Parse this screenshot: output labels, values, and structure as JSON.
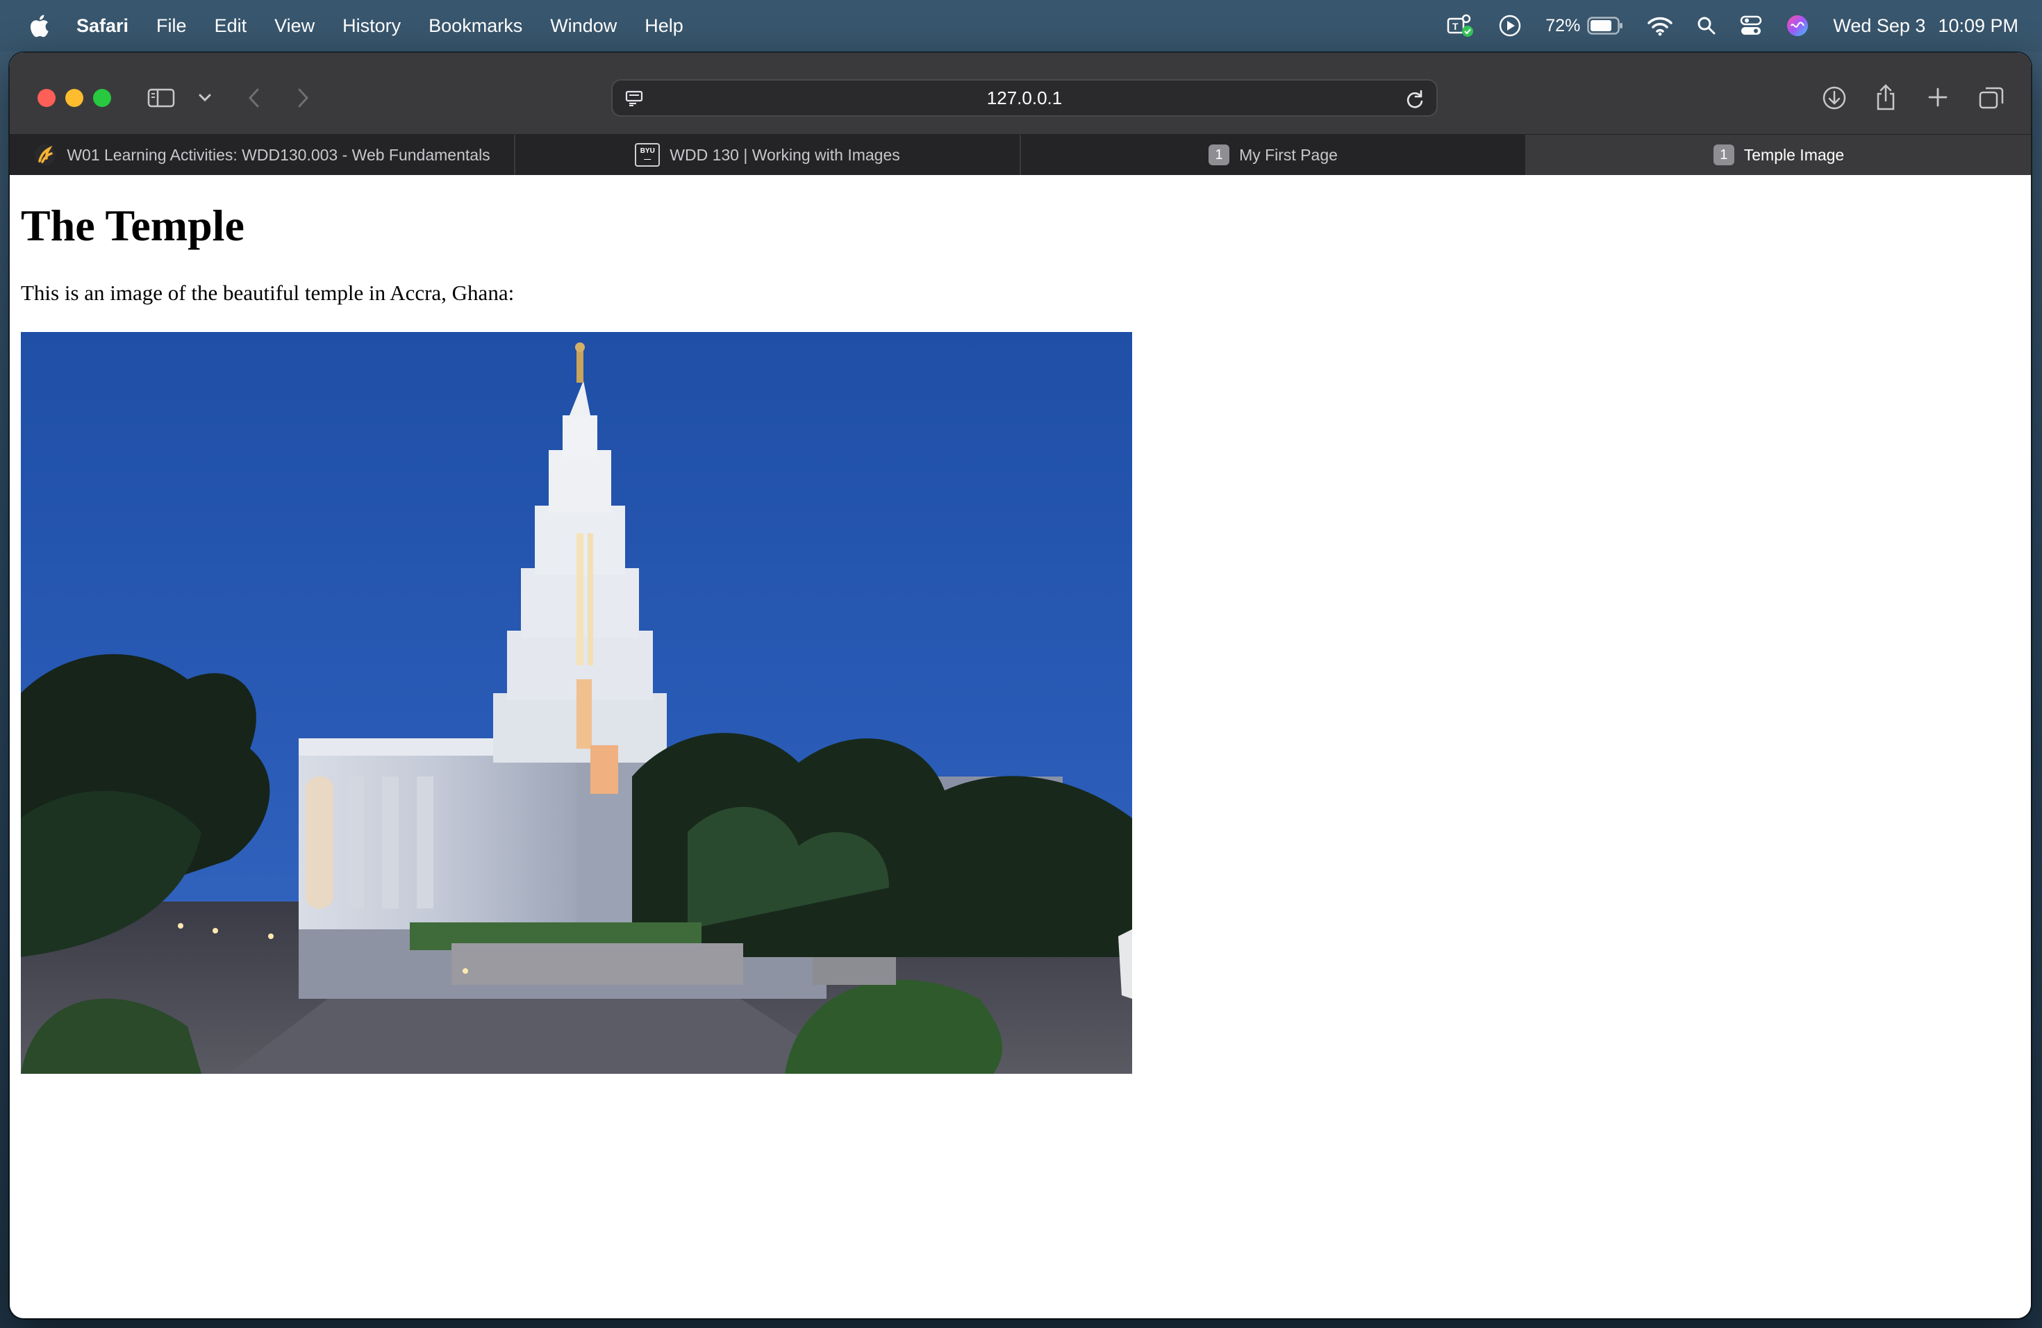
{
  "menubar": {
    "app_name": "Safari",
    "items": [
      "File",
      "Edit",
      "View",
      "History",
      "Bookmarks",
      "Window",
      "Help"
    ],
    "battery_percent": "72%",
    "date": "Wed Sep 3",
    "time": "10:09 PM"
  },
  "browser": {
    "address": "127.0.0.1",
    "tabs": [
      {
        "title": "W01 Learning Activities: WDD130.003 - Web Fundamentals",
        "icon": "canvas-logo-icon",
        "active": false
      },
      {
        "title": "WDD 130 | Working with Images",
        "icon": "byu-logo-icon",
        "active": false
      },
      {
        "title": "My First Page",
        "icon": "number-badge-icon",
        "badge": "1",
        "active": false
      },
      {
        "title": "Temple Image",
        "icon": "number-badge-icon",
        "badge": "1",
        "active": true
      }
    ]
  },
  "page": {
    "heading": "The Temple",
    "paragraph": "This is an image of the beautiful temple in Accra, Ghana:",
    "image_alt": "Accra Ghana Temple at dusk"
  },
  "colors": {
    "toolbar": "#3a3a3c",
    "tabbar": "#242426",
    "sky": "#1e4a9c",
    "close": "#fe5f57",
    "minimize": "#febc2e",
    "zoom": "#28c840"
  }
}
